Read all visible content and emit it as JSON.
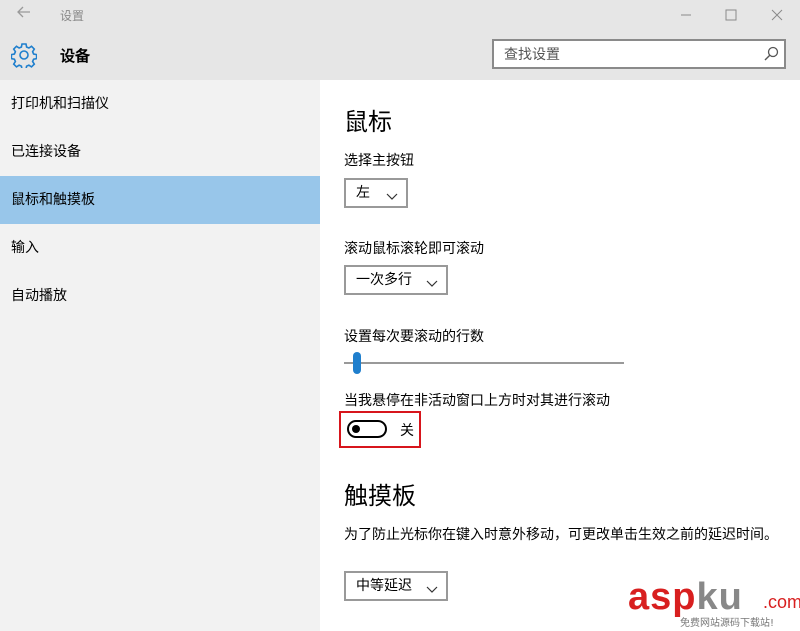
{
  "window": {
    "title": "设置"
  },
  "header": {
    "title": "设备",
    "search_placeholder": "查找设置"
  },
  "sidebar": {
    "items": [
      {
        "label": "打印机和扫描仪"
      },
      {
        "label": "已连接设备"
      },
      {
        "label": "鼠标和触摸板",
        "selected": true
      },
      {
        "label": "输入"
      },
      {
        "label": "自动播放"
      }
    ]
  },
  "mouse": {
    "heading": "鼠标",
    "primary_button_label": "选择主按钮",
    "primary_button_value": "左",
    "scroll_label": "滚动鼠标滚轮即可滚动",
    "scroll_value": "一次多行",
    "lines_label": "设置每次要滚动的行数",
    "lines_slider_fraction": 0.02,
    "inactive_scroll_label": "当我悬停在非活动窗口上方时对其进行滚动",
    "inactive_scroll_state": "关"
  },
  "touchpad": {
    "heading": "触摸板",
    "description": "为了防止光标你在键入时意外移动，可更改单击生效之前的延迟时间。",
    "delay_value": "中等延迟"
  },
  "watermark": {
    "brand": "asp",
    "brand2": "ku",
    "domain": ".com",
    "caption": "免费网站源码下载站!"
  },
  "colors": {
    "accent": "#1f7fcd",
    "selected_item": "#98c6ea",
    "highlight_box": "#d7151c"
  }
}
